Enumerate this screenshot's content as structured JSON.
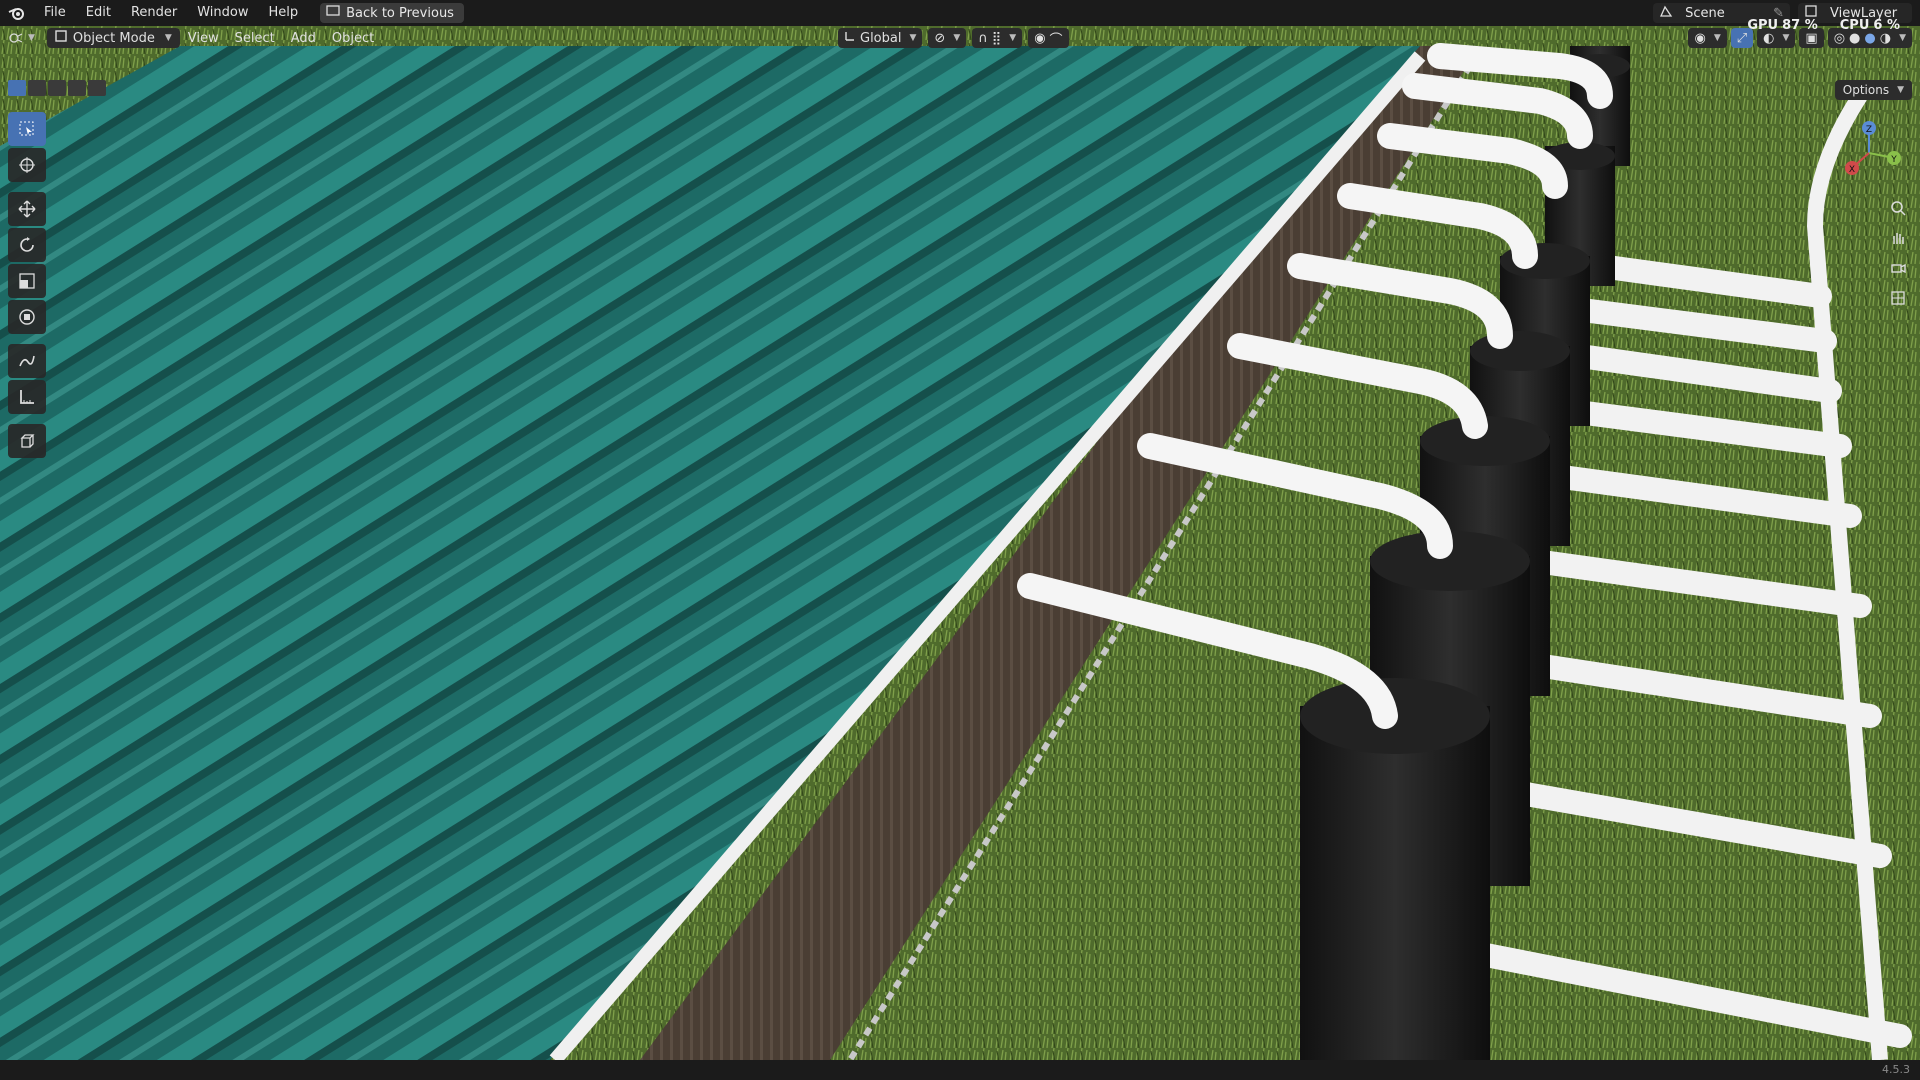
{
  "menu": {
    "items": [
      "File",
      "Edit",
      "Render",
      "Window",
      "Help"
    ],
    "back_label": "Back to Previous"
  },
  "top_right": {
    "scene": "Scene",
    "view_layer": "ViewLayer",
    "gpu_label": "GPU",
    "gpu_value": "87 %",
    "cpu_label": "CPU",
    "cpu_value": "6 %"
  },
  "viewport_header": {
    "mode": "Object Mode",
    "menus": [
      "View",
      "Select",
      "Add",
      "Object"
    ],
    "orientation": "Global",
    "options": "Options"
  },
  "gizmo": {
    "x": "X",
    "y": "Y",
    "z": "Z"
  },
  "status": {
    "version": "4.5.3"
  },
  "colors": {
    "accent": "#4772b3",
    "roof": "#1f6f6a",
    "grass": "#4a6a2a",
    "pipe": "#f2f2f2",
    "tank": "#1c1c1c"
  },
  "tools": [
    "select-box",
    "cursor",
    "move",
    "rotate",
    "scale",
    "transform",
    "annotate",
    "measure",
    "add-cube"
  ]
}
